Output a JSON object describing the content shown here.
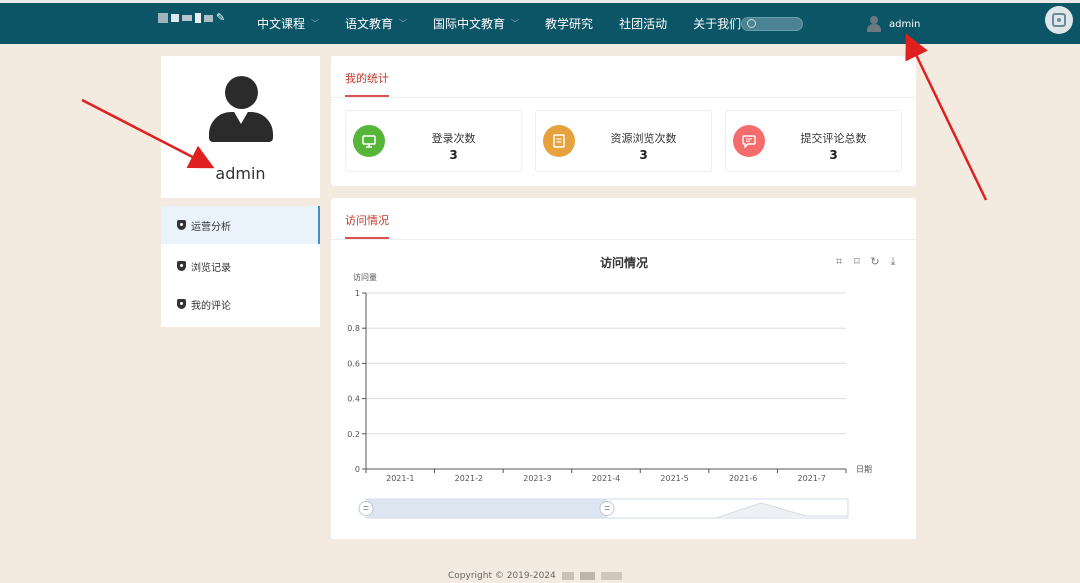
{
  "nav": {
    "items": [
      {
        "label": "中文课程",
        "dropdown": true
      },
      {
        "label": "语文教育",
        "dropdown": true
      },
      {
        "label": "国际中文教育",
        "dropdown": true
      },
      {
        "label": "教学研究",
        "dropdown": false
      },
      {
        "label": "社团活动",
        "dropdown": false
      },
      {
        "label": "关于我们",
        "dropdown": false
      }
    ],
    "user_name": "admin"
  },
  "profile": {
    "name": "admin"
  },
  "side_menu": {
    "items": [
      {
        "label": "运营分析",
        "active": true
      },
      {
        "label": "浏览记录",
        "active": false
      },
      {
        "label": "我的评论",
        "active": false
      }
    ]
  },
  "stats": {
    "title": "我的统计",
    "boxes": [
      {
        "label": "登录次数",
        "value": "3",
        "icon": "monitor-icon",
        "color": "#56b63a"
      },
      {
        "label": "资源浏览次数",
        "value": "3",
        "icon": "document-icon",
        "color": "#e6a23c"
      },
      {
        "label": "提交评论总数",
        "value": "3",
        "icon": "comment-icon",
        "color": "#f56c6c"
      }
    ]
  },
  "visits": {
    "section_title": "访问情况"
  },
  "chart_data": {
    "type": "line",
    "title": "访问情况",
    "ylabel": "访问量",
    "xlabel": "日期",
    "categories": [
      "2021-1",
      "2021-2",
      "2021-3",
      "2021-4",
      "2021-5",
      "2021-6",
      "2021-7"
    ],
    "y_ticks": [
      "0",
      "0.2",
      "0.4",
      "0.6",
      "0.8",
      "1"
    ],
    "ylim": [
      0,
      1
    ],
    "series": [],
    "grid": true,
    "datazoom": {
      "start_percent": 0,
      "end_percent": 50
    }
  },
  "footer": {
    "copyright": "Copyright © 2019-2024"
  },
  "colors": {
    "nav_bg": "#0b5566",
    "page_bg": "#f3ebe0",
    "accent_red": "#d9534f",
    "active_blue": "#3d8fd1"
  }
}
